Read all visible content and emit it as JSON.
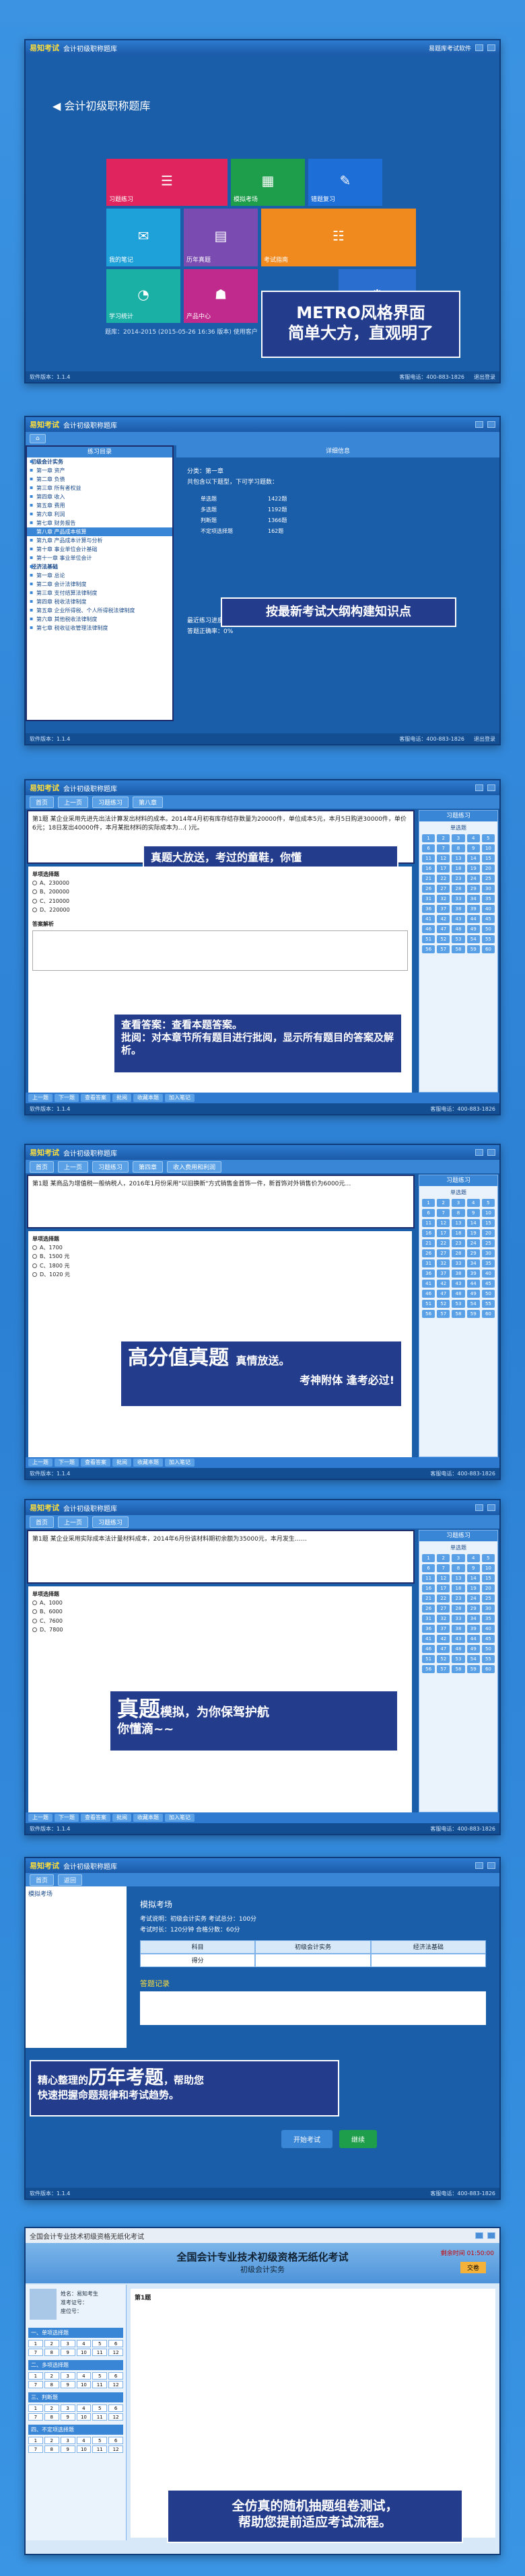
{
  "app": {
    "logo": "易知考试",
    "window_title": "会计初级职称题库",
    "top_right": "易题库考试软件",
    "title2_bank": "会计初级职称题库"
  },
  "panel1": {
    "header": "会计初级职称题库",
    "tiles": [
      {
        "label": "习题练习",
        "icon": "list-icon",
        "color": "#e0245e"
      },
      {
        "label": "模拟考场",
        "icon": "tablet-icon",
        "color": "#1e9e4a"
      },
      {
        "label": "错题复习",
        "icon": "pencil-icon",
        "color": "#1e6ed8"
      },
      {
        "label": "我的笔记",
        "icon": "note-icon",
        "color": "#1ea0d8"
      },
      {
        "label": "历年真题",
        "icon": "book-icon",
        "color": "#7a4bb0"
      },
      {
        "label": "考试指南",
        "icon": "guide-icon",
        "color": "#f08a1e"
      },
      {
        "label": "学习统计",
        "icon": "chart-icon",
        "color": "#1ab0a6"
      },
      {
        "label": "产品中心",
        "icon": "shop-icon",
        "color": "#c02a8c"
      },
      {
        "label": "设置",
        "icon": "gear-icon",
        "color": "#2a6fd0"
      }
    ],
    "footer_text": "题库：2014-2015 (2015-05-26 16:36 版本) 使用客户",
    "callout_line1": "METRO风格界面",
    "callout_line2": "简单大方，直观明了",
    "status_left": "软件版本：1.1.4",
    "status_right": "客服电话：400-883-1826",
    "status_exit": "退出登录"
  },
  "panel2": {
    "tree_title": "练习目录",
    "detail_title": "详细信息",
    "tree": [
      "初级会计实务",
      "第一章 资产",
      "第二章 负债",
      "第三章 所有者权益",
      "第四章 收入",
      "第五章 费用",
      "第六章 利润",
      "第七章 财务报告",
      "第八章 产品成本核算",
      "第九章 产品成本计算与分析",
      "第十章 事业单位会计基础",
      "第十一章 事业单位会计",
      "经济法基础",
      "第一章 总论",
      "第二章 会计法律制度",
      "第三章 支付结算法律制度",
      "第四章 税收法律制度",
      "第五章 企业所得税、个人所得税法律制度",
      "第六章 其他税收法律制度",
      "第七章 税收征收管理法律制度"
    ],
    "detail_lines": [
      "分类：第一章",
      "共包含以下题型，下可学习题数："
    ],
    "stats": [
      {
        "label": "单选题",
        "value": "1422题"
      },
      {
        "label": "多选题",
        "value": "1192题"
      },
      {
        "label": "判断题",
        "value": "1366题"
      },
      {
        "label": "不定项选择题",
        "value": "162题"
      }
    ],
    "footer_lines": [
      "最近练习进度：0 / 4861",
      "答题正确率：0%"
    ],
    "callout": "按最新考试大纲构建知识点"
  },
  "panel3": {
    "nav": [
      "首页",
      "上一页",
      "习题练习",
      "第八章"
    ],
    "question": "第1题 某企业采用先进先出法计算发出材料的成本。2014年4月初有库存结存数量为20000件，单位成本5元，本月5日购进30000件，单价6元；18日发出40000件，本月某批材料的实际成本为…(  )元。",
    "qtype": "单项选择题",
    "options": [
      "A、230000",
      "B、200000",
      "C、210000",
      "D、220000"
    ],
    "answer_title": "答案解析",
    "callout_top": "真题大放送，考过的童鞋，你懂",
    "callout_bottom_line1": "查看答案：查看本题答案。",
    "callout_bottom_line2": "批阅：对本章节所有题目进行批阅，显示所有题目的答案及解析。",
    "right_title": "习题练习",
    "right_label": "单选题",
    "bottom_tabs": [
      "上一题",
      "下一题",
      "查看答案",
      "批阅",
      "收藏本题",
      "加入笔记"
    ]
  },
  "panel4": {
    "nav": [
      "首页",
      "上一页",
      "习题练习",
      "第四章",
      "收入费用和利润"
    ],
    "question": "第1题 某商品为增值税一般纳税人，2016年1月份采用\"以旧换新\"方式销售金首饰一件，新首饰对外销售价为6000元…",
    "qtype": "单项选择题",
    "options": [
      "A、1700",
      "B、1500 元",
      "C、1800 元",
      "D、1020 元"
    ],
    "callout_big": "高分值真题",
    "callout_small": "真情放送。",
    "callout_line2": "考神附体 逢考必过!"
  },
  "panel5": {
    "nav": [
      "首页",
      "上一页",
      "习题练习"
    ],
    "question": "第1题 某企业采用实际成本法计量材料成本，2014年6月份该材料期初余额为35000元，本月发生……",
    "qtype": "单项选择题",
    "options": [
      "A、1000",
      "B、6000",
      "C、7600",
      "D、7800"
    ],
    "callout_big": "真题",
    "callout_text": "模拟，为你保驾护航",
    "callout_line2": "你懂滴~~"
  },
  "panel6": {
    "nav": [
      "首页",
      "返回"
    ],
    "tree_title": "模拟考场",
    "exam_title": "模拟考场",
    "exam_lines": [
      "考试说明：初级会计实务 考试总分：100分",
      "考试时长：120分钟 合格分数：60分"
    ],
    "table_headers": [
      "科目",
      "初级会计实务",
      "经济法基础"
    ],
    "table_row": [
      "得分",
      "",
      ""
    ],
    "record_title": "答题记录",
    "callout_line1_prefix": "精心整理的",
    "callout_line1_big": "历年考题",
    "callout_line1_suffix": "，帮助您",
    "callout_line2": "快速把握命题规律和考试趋势。",
    "buttons": [
      "开始考试",
      "继续"
    ]
  },
  "panel7": {
    "window_title": "全国会计专业技术初级资格无纸化考试",
    "subtitle": "初级会计实务",
    "candidate": [
      "姓名：易知考生",
      "准考证号：",
      "座位号："
    ],
    "sections": [
      "一、单项选择题",
      "二、多项选择题",
      "三、判断题",
      "四、不定项选择题"
    ],
    "submit": "交卷",
    "time_label": "剩余时间 01:50:00",
    "question_title": "第1题",
    "callout_line1": "全仿真的随机抽题组卷测试，",
    "callout_line2": "帮助您提前适应考试流程。"
  }
}
